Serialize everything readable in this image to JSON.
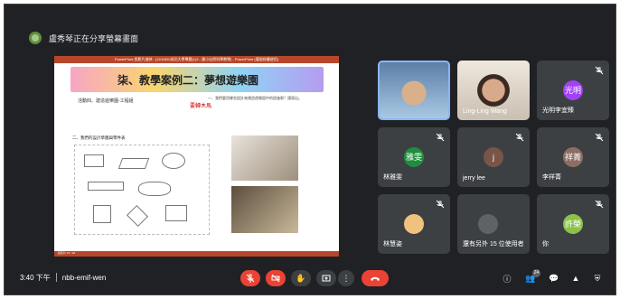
{
  "topbar": {
    "presenting_text": "盧秀琴正在分享螢幕畫面"
  },
  "slide": {
    "window_title": "PowerPoint 投影片放映 - [1100520成功大學專題(1)5 - 國小自然科學教學] - PowerPoint (僅限授權使用)",
    "title": "柒、教學案例二：夢想遊樂園",
    "subtitle": "活動四、建造遊樂園-工程組",
    "note": "要轉木馬",
    "right_question": "一、我們要用哪些設計來建造遊樂園中的設施呢？請寫出。",
    "section2": "二、我們的設計草圖與零件表",
    "footer": "投影片 15 / 18"
  },
  "participants": [
    {
      "name": "",
      "type": "video",
      "muted": false
    },
    {
      "name": "Ling-Ling Wang",
      "type": "video",
      "muted": false
    },
    {
      "name": "光明李宜臻",
      "type": "avatar",
      "initial": "光明",
      "color": "#a142f4",
      "muted": true
    },
    {
      "name": "林雅雯",
      "type": "avatar",
      "initial": "雅雯",
      "color": "#1e8e3e",
      "muted": true
    },
    {
      "name": "jerry lee",
      "type": "avatar",
      "initial": "j",
      "color": "#795548",
      "muted": true
    },
    {
      "name": "李祥菁",
      "type": "avatar",
      "initial": "祥菁",
      "color": "#8d6e63",
      "muted": true
    },
    {
      "name": "林慧姿",
      "type": "avatar",
      "initial": "",
      "color": "#f1c27d",
      "muted": true
    },
    {
      "name": "還有另外 15 位使用者",
      "type": "others",
      "muted": false
    },
    {
      "name": "你",
      "type": "avatar",
      "initial": "許榮",
      "color": "#8bc34a",
      "muted": true
    }
  ],
  "bottom": {
    "time": "3:40 下午",
    "meeting_code": "nbb-emif-wen",
    "participants_count": "24"
  },
  "colors": {
    "bg": "#202124",
    "tile": "#3c4043",
    "danger": "#ea4335",
    "active_border": "#8ab4f8"
  }
}
